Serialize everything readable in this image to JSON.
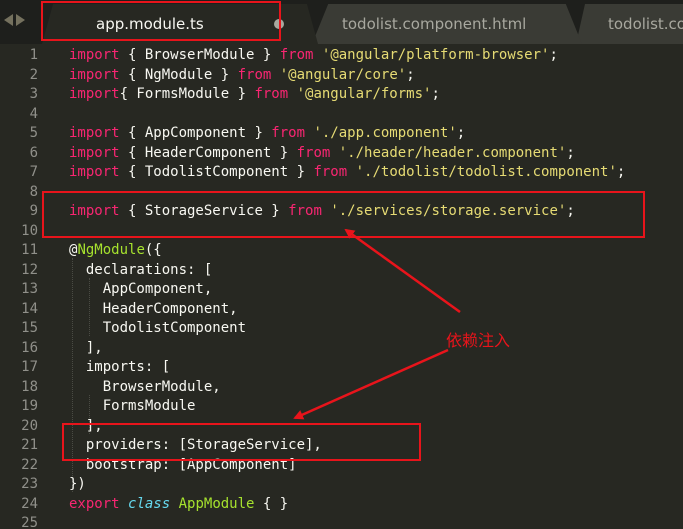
{
  "tabs": [
    {
      "label": "app.module.ts",
      "active": true,
      "modified": true
    },
    {
      "label": "todolist.component.html",
      "active": false
    },
    {
      "label": "todolist.com",
      "active": false
    }
  ],
  "code_lines": [
    {
      "n": "1",
      "tokens": [
        {
          "t": "import",
          "c": "kw"
        },
        {
          "t": " { BrowserModule } ",
          "c": ""
        },
        {
          "t": "from",
          "c": "kw"
        },
        {
          "t": " ",
          "c": ""
        },
        {
          "t": "'@angular/platform-browser'",
          "c": "str"
        },
        {
          "t": ";",
          "c": ""
        }
      ]
    },
    {
      "n": "2",
      "tokens": [
        {
          "t": "import",
          "c": "kw"
        },
        {
          "t": " { NgModule } ",
          "c": ""
        },
        {
          "t": "from",
          "c": "kw"
        },
        {
          "t": " ",
          "c": ""
        },
        {
          "t": "'@angular/core'",
          "c": "str"
        },
        {
          "t": ";",
          "c": ""
        }
      ]
    },
    {
      "n": "3",
      "tokens": [
        {
          "t": "import",
          "c": "kw"
        },
        {
          "t": "{ FormsModule } ",
          "c": ""
        },
        {
          "t": "from",
          "c": "kw"
        },
        {
          "t": " ",
          "c": ""
        },
        {
          "t": "'@angular/forms'",
          "c": "str"
        },
        {
          "t": ";",
          "c": ""
        }
      ]
    },
    {
      "n": "4",
      "tokens": []
    },
    {
      "n": "5",
      "tokens": [
        {
          "t": "import",
          "c": "kw"
        },
        {
          "t": " { AppComponent } ",
          "c": ""
        },
        {
          "t": "from",
          "c": "kw"
        },
        {
          "t": " ",
          "c": ""
        },
        {
          "t": "'./app.component'",
          "c": "str"
        },
        {
          "t": ";",
          "c": ""
        }
      ]
    },
    {
      "n": "6",
      "tokens": [
        {
          "t": "import",
          "c": "kw"
        },
        {
          "t": " { HeaderComponent } ",
          "c": ""
        },
        {
          "t": "from",
          "c": "kw"
        },
        {
          "t": " ",
          "c": ""
        },
        {
          "t": "'./header/header.component'",
          "c": "str"
        },
        {
          "t": ";",
          "c": ""
        }
      ]
    },
    {
      "n": "7",
      "tokens": [
        {
          "t": "import",
          "c": "kw"
        },
        {
          "t": " { TodolistComponent } ",
          "c": ""
        },
        {
          "t": "from",
          "c": "kw"
        },
        {
          "t": " ",
          "c": ""
        },
        {
          "t": "'./todolist/todolist.component'",
          "c": "str"
        },
        {
          "t": ";",
          "c": ""
        }
      ]
    },
    {
      "n": "8",
      "tokens": []
    },
    {
      "n": "9",
      "tokens": [
        {
          "t": "import",
          "c": "kw"
        },
        {
          "t": " { StorageService } ",
          "c": ""
        },
        {
          "t": "from",
          "c": "kw"
        },
        {
          "t": " ",
          "c": ""
        },
        {
          "t": "'./services/storage.service'",
          "c": "str"
        },
        {
          "t": ";",
          "c": ""
        }
      ]
    },
    {
      "n": "10",
      "tokens": []
    },
    {
      "n": "11",
      "tokens": [
        {
          "t": "@",
          "c": ""
        },
        {
          "t": "NgModule",
          "c": "fn"
        },
        {
          "t": "({",
          "c": ""
        }
      ]
    },
    {
      "n": "12",
      "tokens": [
        {
          "t": "  declarations: [",
          "c": ""
        }
      ]
    },
    {
      "n": "13",
      "tokens": [
        {
          "t": "    AppComponent,",
          "c": ""
        }
      ]
    },
    {
      "n": "14",
      "tokens": [
        {
          "t": "    HeaderComponent,",
          "c": ""
        }
      ]
    },
    {
      "n": "15",
      "tokens": [
        {
          "t": "    TodolistComponent",
          "c": ""
        }
      ]
    },
    {
      "n": "16",
      "tokens": [
        {
          "t": "  ],",
          "c": ""
        }
      ]
    },
    {
      "n": "17",
      "tokens": [
        {
          "t": "  imports: [",
          "c": ""
        }
      ]
    },
    {
      "n": "18",
      "tokens": [
        {
          "t": "    BrowserModule,",
          "c": ""
        }
      ]
    },
    {
      "n": "19",
      "tokens": [
        {
          "t": "    FormsModule",
          "c": ""
        }
      ]
    },
    {
      "n": "20",
      "tokens": [
        {
          "t": "  ],",
          "c": ""
        }
      ]
    },
    {
      "n": "21",
      "tokens": [
        {
          "t": "  providers: [StorageService],",
          "c": ""
        }
      ]
    },
    {
      "n": "22",
      "tokens": [
        {
          "t": "  bootstrap: [AppComponent]",
          "c": ""
        }
      ]
    },
    {
      "n": "23",
      "tokens": [
        {
          "t": "})",
          "c": ""
        }
      ]
    },
    {
      "n": "24",
      "tokens": [
        {
          "t": "export",
          "c": "kw"
        },
        {
          "t": " ",
          "c": ""
        },
        {
          "t": "class",
          "c": "st"
        },
        {
          "t": " ",
          "c": ""
        },
        {
          "t": "AppModule",
          "c": "fn"
        },
        {
          "t": " { }",
          "c": ""
        }
      ]
    },
    {
      "n": "25",
      "tokens": []
    }
  ],
  "annotation": {
    "label": "依赖注入"
  },
  "colors": {
    "background": "#272822",
    "keyword": "#f92672",
    "string": "#e6db74",
    "function": "#a6e22e",
    "storage": "#66d9ef",
    "annotation": "#e8141b"
  }
}
